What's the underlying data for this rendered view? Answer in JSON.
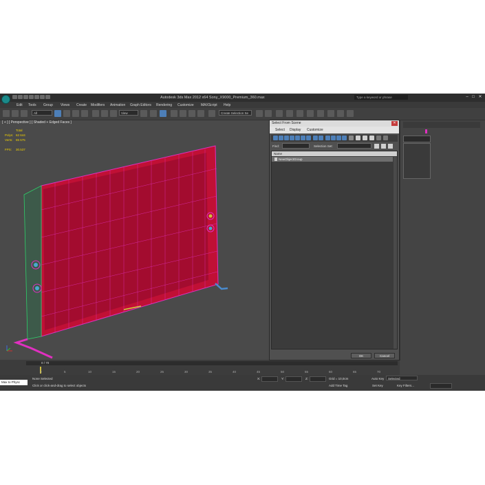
{
  "window": {
    "title": "Autodesk 3ds Max 2012 x64    Sony_X9000_Premium_360.max",
    "search_placeholder": "Type a keyword or phrase",
    "min": "–",
    "max": "□",
    "close": "✕"
  },
  "menu": [
    "Edit",
    "Tools",
    "Group",
    "Views",
    "Create",
    "Modifiers",
    "Animation",
    "Graph Editors",
    "Rendering",
    "Customize",
    "MAXScript",
    "Help"
  ],
  "toolbar": {
    "filter_value": "All",
    "refcoord_value": "View",
    "named_selection_placeholder": "Create Selection Se"
  },
  "viewport": {
    "label": "[ + ] [ Perspective ] [ Shaded + Edged Faces ]",
    "stats": {
      "header": "Total",
      "polys_label": "Polys:",
      "polys_value": "62 644",
      "verts_label": "Verts:",
      "verts_value": "65 675",
      "fps_label": "FPS:",
      "fps_value": "30.537"
    }
  },
  "dialog": {
    "title": "Select From Scene",
    "close_label": "✕",
    "menu": [
      "Select",
      "Display",
      "Customize"
    ],
    "find_label": "Find:",
    "find_value": "",
    "selection_set_label": "Selection Set:",
    "column_name": "Name",
    "rows": [
      "NewObjectGroup"
    ],
    "ok_label": "OK",
    "cancel_label": "Cancel"
  },
  "timeline": {
    "slider_value": "0 / 70",
    "ticks": [
      "0",
      "5",
      "10",
      "15",
      "20",
      "25",
      "30",
      "35",
      "40",
      "45",
      "50",
      "55",
      "60",
      "65",
      "70"
    ]
  },
  "status": {
    "maxscript_label": "Max to Physc",
    "selection_text": "None Selected",
    "prompt_text": "Click or click-and-drag to select objects",
    "x_label": "X:",
    "y_label": "Y:",
    "z_label": "Z:",
    "grid_text": "Grid = 10,0cm",
    "add_time_tag": "Add Time Tag",
    "auto_key": "Auto Key",
    "set_key": "Set Key",
    "selected_option": "Selected",
    "key_filters": "Key Filters..."
  },
  "colors": {
    "accent_close": "#c43a3a",
    "stats_yellow": "#f0d000",
    "wireframe_magenta": "#e030c0",
    "screen_red": "#c01035"
  }
}
